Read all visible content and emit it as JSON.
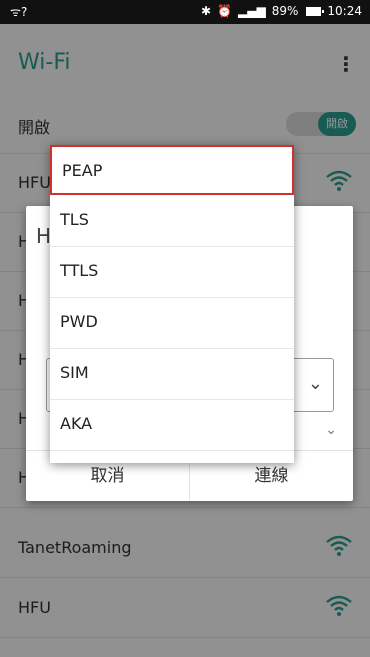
{
  "status_bar": {
    "signal_left": "ᯤ?",
    "bluetooth_icon": "✱",
    "alarm_icon": "⏰",
    "signal_bars": "▂▄▆",
    "battery": "89%",
    "time": "10:24"
  },
  "app": {
    "title": "Wi-Fi",
    "menu_label": "⋮",
    "toggle_row": {
      "label": "開啟",
      "toggle_text": "開啟"
    },
    "networks": [
      {
        "label": "HFU"
      },
      {
        "label": "H"
      },
      {
        "label": "H"
      },
      {
        "label": "H"
      },
      {
        "label": "H"
      },
      {
        "label": "H"
      },
      {
        "label": "TanetRoaming"
      },
      {
        "label": "HFU"
      }
    ]
  },
  "dialog": {
    "title_fragment": "H",
    "select_chevron": "⌄",
    "secondary_chevron": "⌄",
    "cancel_label": "取消",
    "connect_label": "連線"
  },
  "dropdown": {
    "items": [
      "PEAP",
      "TLS",
      "TTLS",
      "PWD",
      "SIM",
      "AKA"
    ],
    "selected": "PEAP"
  },
  "colors": {
    "accent": "#2a9d8f",
    "selected_border": "#d32f2f"
  }
}
